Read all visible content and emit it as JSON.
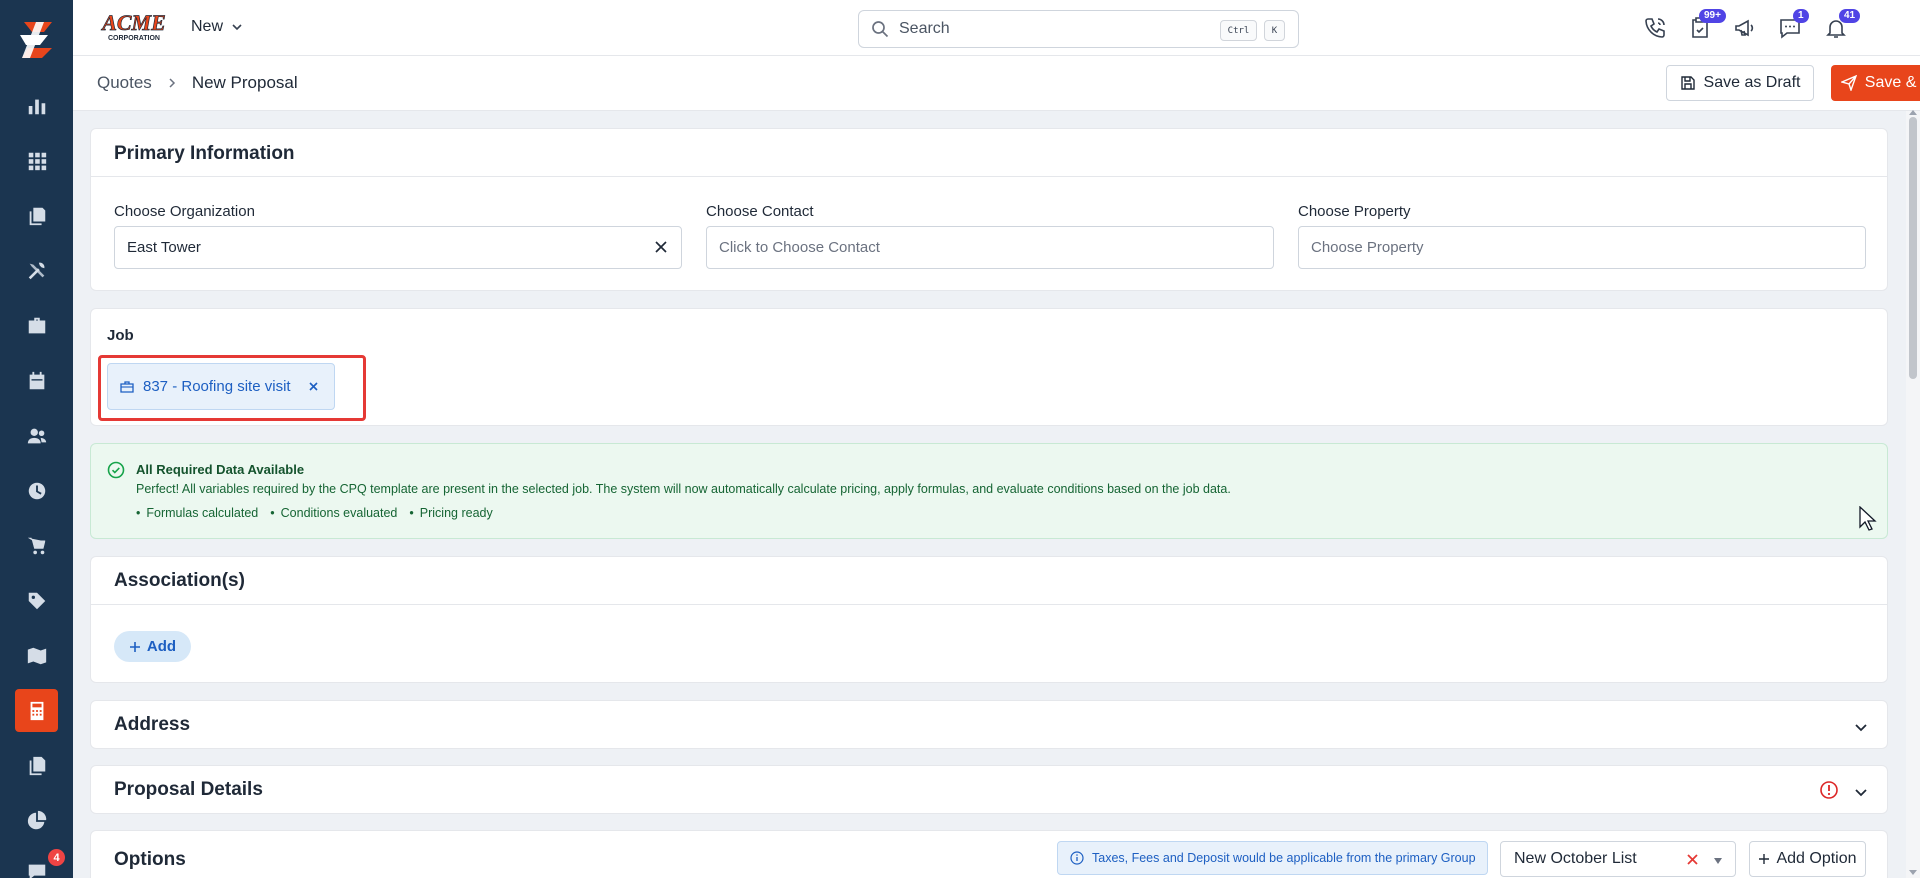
{
  "brand": {
    "name": "ACME",
    "sub": "CORPORATION"
  },
  "topbar": {
    "new_label": "New",
    "search_placeholder": "Search",
    "shortcut_keys": [
      "Ctrl",
      "K"
    ],
    "badges": {
      "tasks": "99+",
      "messages": "1",
      "notifications": "41"
    }
  },
  "breadcrumb": {
    "parent": "Quotes",
    "current": "New Proposal"
  },
  "actions": {
    "draft": "Save as Draft",
    "send": "Save & Send"
  },
  "primary": {
    "title": "Primary Information",
    "organization": {
      "label": "Choose Organization",
      "value": "East Tower"
    },
    "contact": {
      "label": "Choose Contact",
      "placeholder": "Click to Choose Contact"
    },
    "property": {
      "label": "Choose Property",
      "placeholder": "Choose Property"
    }
  },
  "job": {
    "label": "Job",
    "chip": "837 - Roofing site visit"
  },
  "alert": {
    "title": "All Required Data Available",
    "body": "Perfect! All variables required by the CPQ template are present in the selected job. The system will now automatically calculate pricing, apply formulas, and evaluate conditions based on the job data.",
    "items": [
      "Formulas calculated",
      "Conditions evaluated",
      "Pricing ready"
    ]
  },
  "associations": {
    "title": "Association(s)",
    "add_label": "Add"
  },
  "address": {
    "title": "Address"
  },
  "details": {
    "title": "Proposal Details"
  },
  "options": {
    "title": "Options",
    "tax_note": "Taxes, Fees and Deposit would be applicable from the primary Group",
    "list_value": "New October List",
    "add_option_label": "Add Option"
  },
  "sidebar_badge": "4",
  "colors": {
    "accent": "#e8451b",
    "sidebar": "#1b3550",
    "link": "#1d5fc2",
    "success": "#166534"
  }
}
